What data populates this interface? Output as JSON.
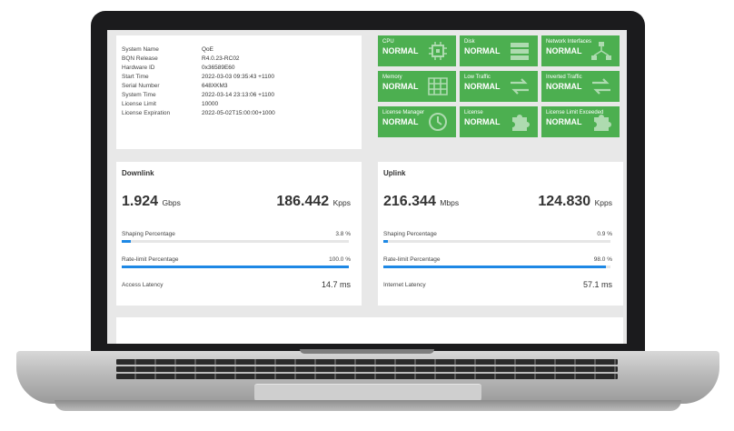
{
  "system_info": [
    {
      "key": "System Name",
      "value": "QoE"
    },
    {
      "key": "BQN Release",
      "value": "R4.0.23-RC02"
    },
    {
      "key": "Hardware ID",
      "value": "0x36589E60"
    },
    {
      "key": "Start Time",
      "value": "2022-03-03 09:35:43 +1100"
    },
    {
      "key": "Serial Number",
      "value": "648XKM3"
    },
    {
      "key": "System Time",
      "value": "2022-03-14 23:13:06 +1100"
    },
    {
      "key": "License Limit",
      "value": "10000"
    },
    {
      "key": "License Expiration",
      "value": "2022-05-02T15:00:00+1000"
    }
  ],
  "status_tiles": [
    {
      "title": "CPU",
      "status": "NORMAL",
      "icon": "chip-icon"
    },
    {
      "title": "Disk",
      "status": "NORMAL",
      "icon": "server-icon"
    },
    {
      "title": "Network Interfaces",
      "status": "NORMAL",
      "icon": "network-icon"
    },
    {
      "title": "Memory",
      "status": "NORMAL",
      "icon": "grid-icon"
    },
    {
      "title": "Low Traffic",
      "status": "NORMAL",
      "icon": "arrows-icon"
    },
    {
      "title": "Inverted Traffic",
      "status": "NORMAL",
      "icon": "arrows-icon"
    },
    {
      "title": "License Manager",
      "status": "NORMAL",
      "icon": "clock-icon"
    },
    {
      "title": "License",
      "status": "NORMAL",
      "icon": "puzzle-icon"
    },
    {
      "title": "License Limit Exceeded",
      "status": "NORMAL",
      "icon": "puzzle-icon"
    }
  ],
  "downlink": {
    "title": "Downlink",
    "throughput": "1.924",
    "throughput_unit": "Gbps",
    "packets": "186.442",
    "packets_unit": "Kpps",
    "shaping_label": "Shaping Percentage",
    "shaping_pct": "3.8 %",
    "shaping_value": 0.038,
    "ratelimit_label": "Rate-limit Percentage",
    "ratelimit_pct": "100.0 %",
    "ratelimit_value": 1.0,
    "latency_label": "Access Latency",
    "latency": "14.7 ms"
  },
  "uplink": {
    "title": "Uplink",
    "throughput": "216.344",
    "throughput_unit": "Mbps",
    "packets": "124.830",
    "packets_unit": "Kpps",
    "shaping_label": "Shaping Percentage",
    "shaping_pct": "0.9 %",
    "shaping_value": 0.009,
    "ratelimit_label": "Rate-limit Percentage",
    "ratelimit_pct": "98.0 %",
    "ratelimit_value": 0.98,
    "latency_label": "Internet Latency",
    "latency": "57.1 ms"
  },
  "colors": {
    "tile_green": "#4caf50",
    "bar_blue": "#1e88e5"
  }
}
